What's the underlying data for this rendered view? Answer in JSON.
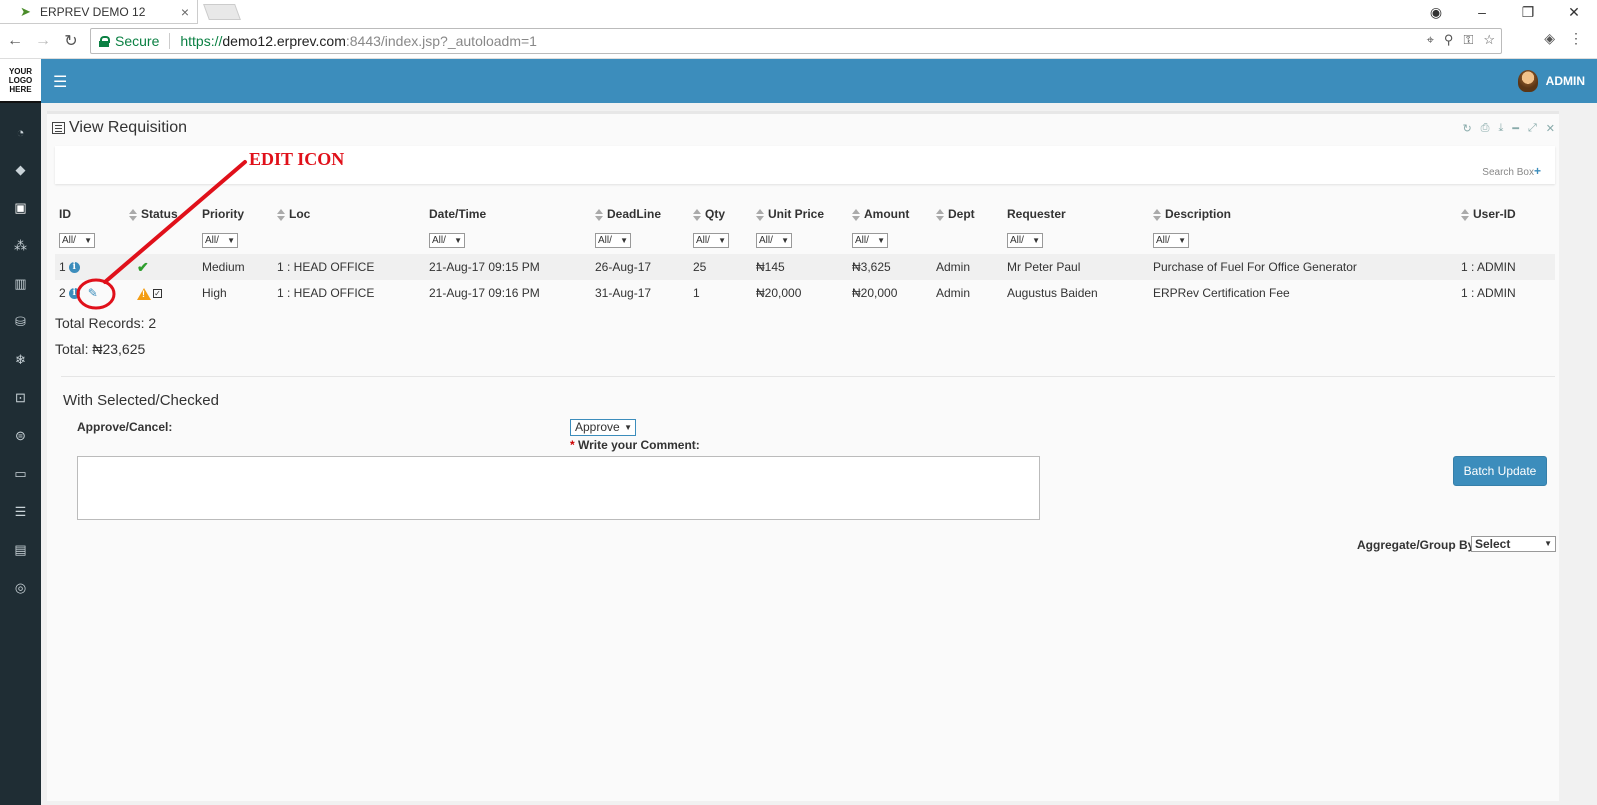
{
  "browser": {
    "tab_title": "ERPREV DEMO 12",
    "secure_label": "Secure",
    "url_scheme": "https://",
    "url_host": "demo12.erprev.com",
    "url_rest": ":8443/index.jsp?_autoloadm=1"
  },
  "app": {
    "logo_lines": [
      "YOUR",
      "LOGO",
      "HERE"
    ],
    "user_label": "ADMIN",
    "accent_color": "#3c8dbc"
  },
  "panel": {
    "title": "View Requisition",
    "search_box_label": "Search Box"
  },
  "table": {
    "headers": [
      "ID",
      "Status",
      "Priority",
      "Loc",
      "Date/Time",
      "DeadLine",
      "Qty",
      "Unit Price",
      "Amount",
      "Dept",
      "Requester",
      "Description",
      "User-ID"
    ],
    "filter_value": "All/",
    "rows": [
      {
        "id": "1",
        "priority": "Medium",
        "loc": "1 : HEAD OFFICE",
        "datetime": "21-Aug-17 09:15 PM",
        "deadline": "26-Aug-17",
        "qty": "25",
        "unit_price": "₦145",
        "amount": "₦3,625",
        "dept": "Admin",
        "requester": "Mr Peter Paul",
        "description": "Purchase of Fuel For Office Generator",
        "user_id": "1 : ADMIN"
      },
      {
        "id": "2",
        "priority": "High",
        "loc": "1 : HEAD OFFICE",
        "datetime": "21-Aug-17 09:16 PM",
        "deadline": "31-Aug-17",
        "qty": "1",
        "unit_price": "₦20,000",
        "amount": "₦20,000",
        "dept": "Admin",
        "requester": "Augustus Baiden",
        "description": "ERPRev Certification Fee",
        "user_id": "1 : ADMIN"
      }
    ]
  },
  "totals": {
    "records": "Total Records: 2",
    "total": "Total: ₦23,625"
  },
  "batch": {
    "section_title": "With Selected/Checked",
    "approve_label": "Approve/Cancel:",
    "approve_value": "Approve",
    "comment_label": "Write your Comment:",
    "button_label": "Batch Update",
    "aggregate_label": "Aggregate/Group By:",
    "aggregate_value": "Select"
  },
  "annotation": {
    "label": "EDIT ICON",
    "color": "#e0101a"
  }
}
